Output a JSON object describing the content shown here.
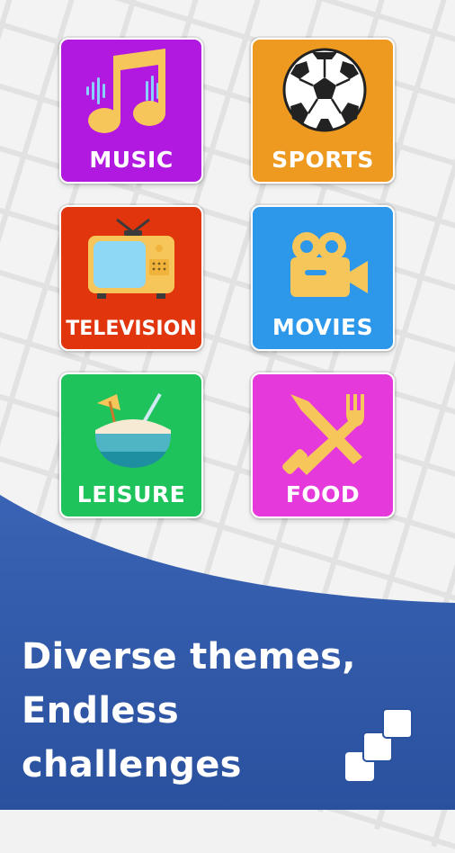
{
  "themes": [
    {
      "label": "MUSIC",
      "color": "#b118e0",
      "icon": "music-note-icon"
    },
    {
      "label": "SPORTS",
      "color": "#ee9a20",
      "icon": "soccer-ball-icon"
    },
    {
      "label": "TELEVISION",
      "color": "#e0350d",
      "icon": "television-icon"
    },
    {
      "label": "MOVIES",
      "color": "#2d97ea",
      "icon": "video-camera-icon"
    },
    {
      "label": "LEISURE",
      "color": "#1fc35c",
      "icon": "coconut-drink-icon"
    },
    {
      "label": "FOOD",
      "color": "#e639db",
      "icon": "knife-fork-icon"
    }
  ],
  "headline": {
    "line1": "Diverse themes,",
    "line2": "Endless",
    "line3": "challenges"
  },
  "colors": {
    "banner": "#2f5aa8",
    "background": "#f2f2f2"
  },
  "logo_icon": "stacked-squares-logo"
}
